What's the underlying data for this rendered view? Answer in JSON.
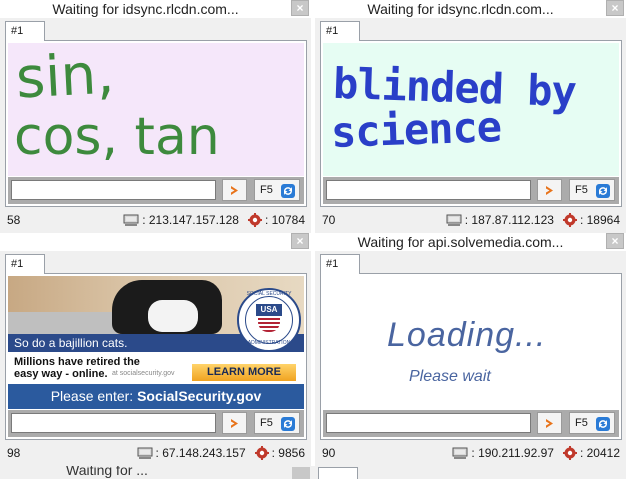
{
  "panes": [
    {
      "title": "Waiting for idsync.rlcdn.com...",
      "tab": "#1",
      "captcha": {
        "line1": "sin,",
        "line2": "cos, tan"
      },
      "input_value": "",
      "refresh_label": "F5",
      "status": {
        "number": "58",
        "ip": ": 213.147.157.128",
        "port": ": 10784"
      }
    },
    {
      "title": "Waiting for idsync.rlcdn.com...",
      "tab": "#1",
      "captcha": {
        "line1": "blinded by",
        "line2": "science"
      },
      "input_value": "",
      "refresh_label": "F5",
      "status": {
        "number": "70",
        "ip": ": 187.87.112.123",
        "port": ": 18964"
      }
    },
    {
      "title": "",
      "tab": "#1",
      "ad": {
        "banner": "So do a bajillion cats.",
        "seal_top": "SOCIAL SECURITY",
        "seal_usa": "USA",
        "seal_bottom": "ADMINISTRATION",
        "text1": "Millions have retired the",
        "text2": "easy way - online.",
        "small": "at socialsecurity.gov",
        "learn_more": "LEARN MORE",
        "enter_prefix": "Please enter: ",
        "enter_value": "SocialSecurity.gov"
      },
      "input_value": "",
      "refresh_label": "F5",
      "status": {
        "number": "98",
        "ip": ": 67.148.243.157",
        "port": ": 9856"
      }
    },
    {
      "title": "Waiting for api.solvemedia.com...",
      "tab": "#1",
      "loading": {
        "big": "Loading...",
        "small": "Please wait"
      },
      "input_value": "",
      "refresh_label": "F5",
      "status": {
        "number": "90",
        "ip": ": 190.211.92.97",
        "port": ": 20412"
      }
    }
  ],
  "bottom_peek_title": "Waiting for ...",
  "close_symbol": "×",
  "colors": {
    "accent_arrow": "#e8731a",
    "refresh_blue": "#2a7bd6",
    "ad_blue": "#2b5a9e"
  }
}
